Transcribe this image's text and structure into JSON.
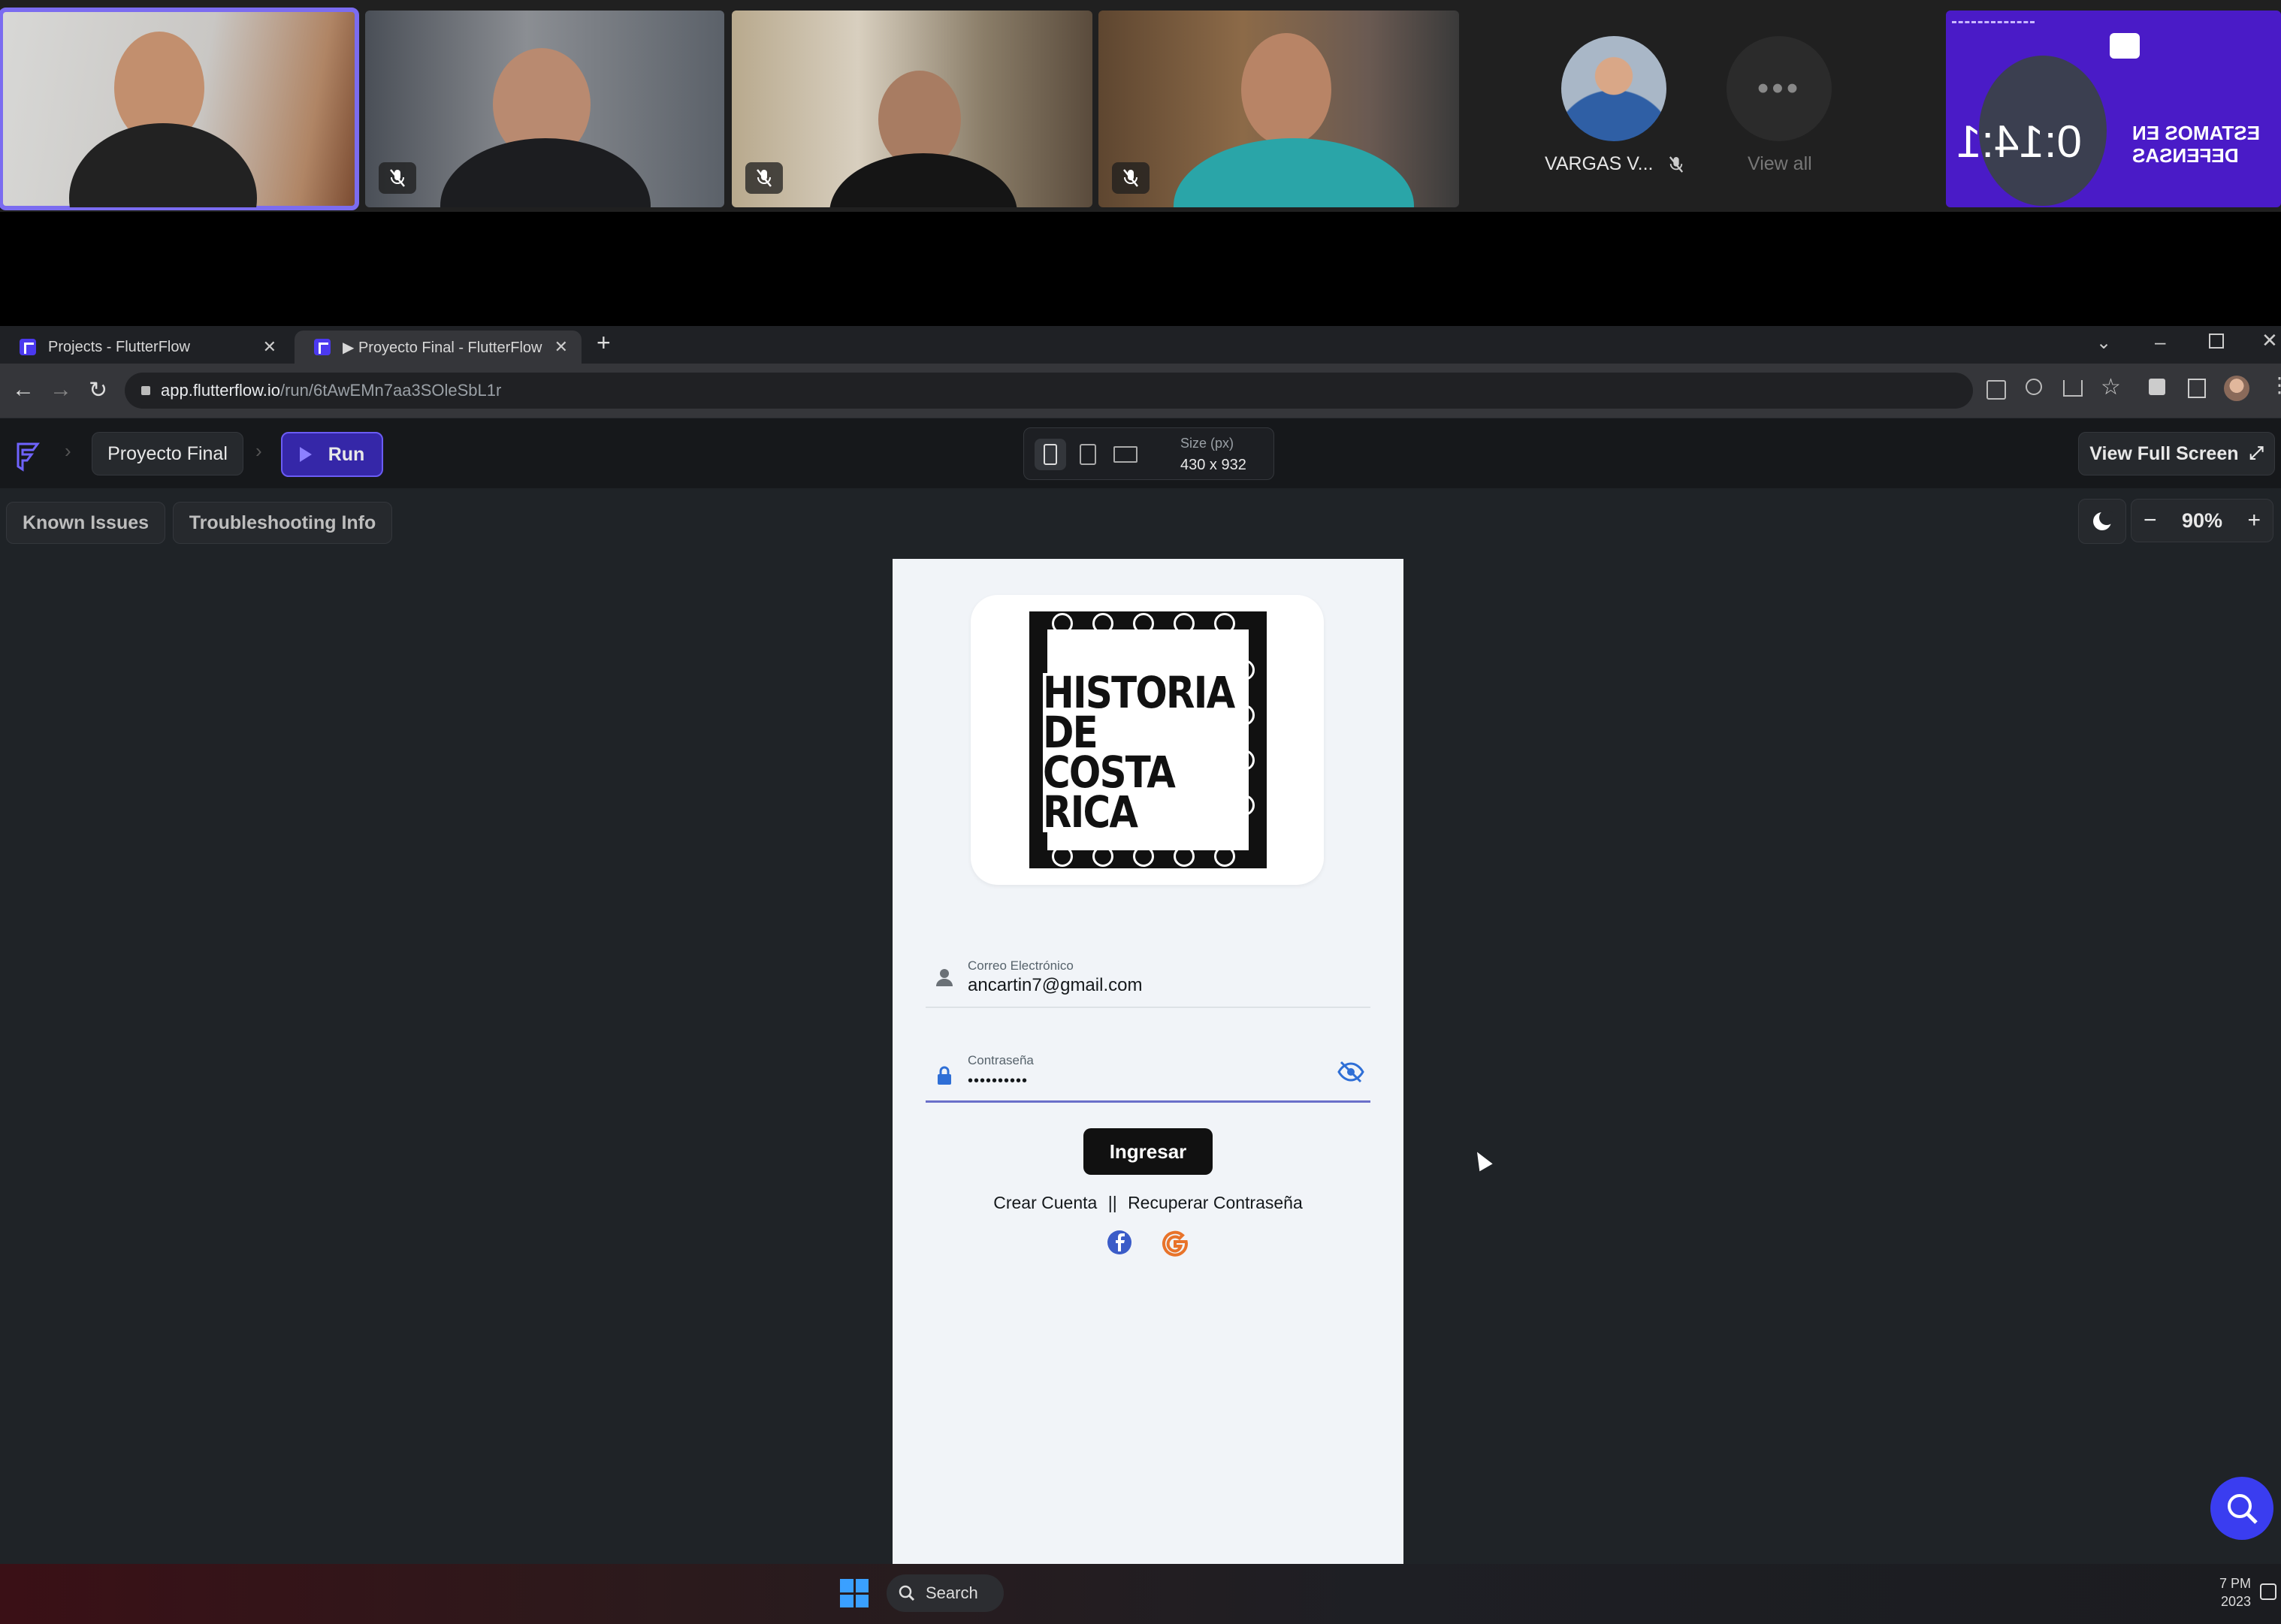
{
  "meeting": {
    "participant_name": "VARGAS V...",
    "view_all_label": "View all",
    "share_timer": "0:14:1",
    "share_banner_line1": "ESTAMOS EN",
    "share_banner_line2": "DEFENSAS",
    "more_dots": "•••"
  },
  "browser": {
    "tabs": [
      {
        "label": "Projects - FlutterFlow"
      },
      {
        "label": "▶ Proyecto Final - FlutterFlow"
      }
    ],
    "url_host": "app.flutterflow.io",
    "url_path": "/run/6tAwEMn7aa3SOleSbL1r"
  },
  "ff": {
    "project_name": "Proyecto Final",
    "run_label": "Run",
    "size_label": "Size (px)",
    "size_value": "430 x 932",
    "view_full_screen": "View Full Screen",
    "known_issues": "Known Issues",
    "troubleshooting": "Troubleshooting Info",
    "zoom": "90%",
    "zoom_minus": "−",
    "zoom_plus": "+"
  },
  "app": {
    "logo_text": [
      "HISTORIA",
      "DE",
      "COSTA",
      "RICA"
    ],
    "email_label": "Correo  Electrónico",
    "email_value": "ancartin7@gmail.com",
    "password_label": "Contraseña",
    "password_value": "••••••••••",
    "login_button": "Ingresar",
    "create_account": "Crear Cuenta",
    "separator": "||",
    "recover_password": "Recuperar Contraseña"
  },
  "taskbar": {
    "search_label": "Search",
    "clock_time": "7 PM",
    "clock_year": "2023"
  },
  "colors": {
    "ff_purple": "#4b39ef",
    "focus_border": "#6a6fc9",
    "facebook_blue": "#3b5cc8",
    "google_orange": "#e8732a",
    "lock_blue": "#2f6fd6"
  }
}
